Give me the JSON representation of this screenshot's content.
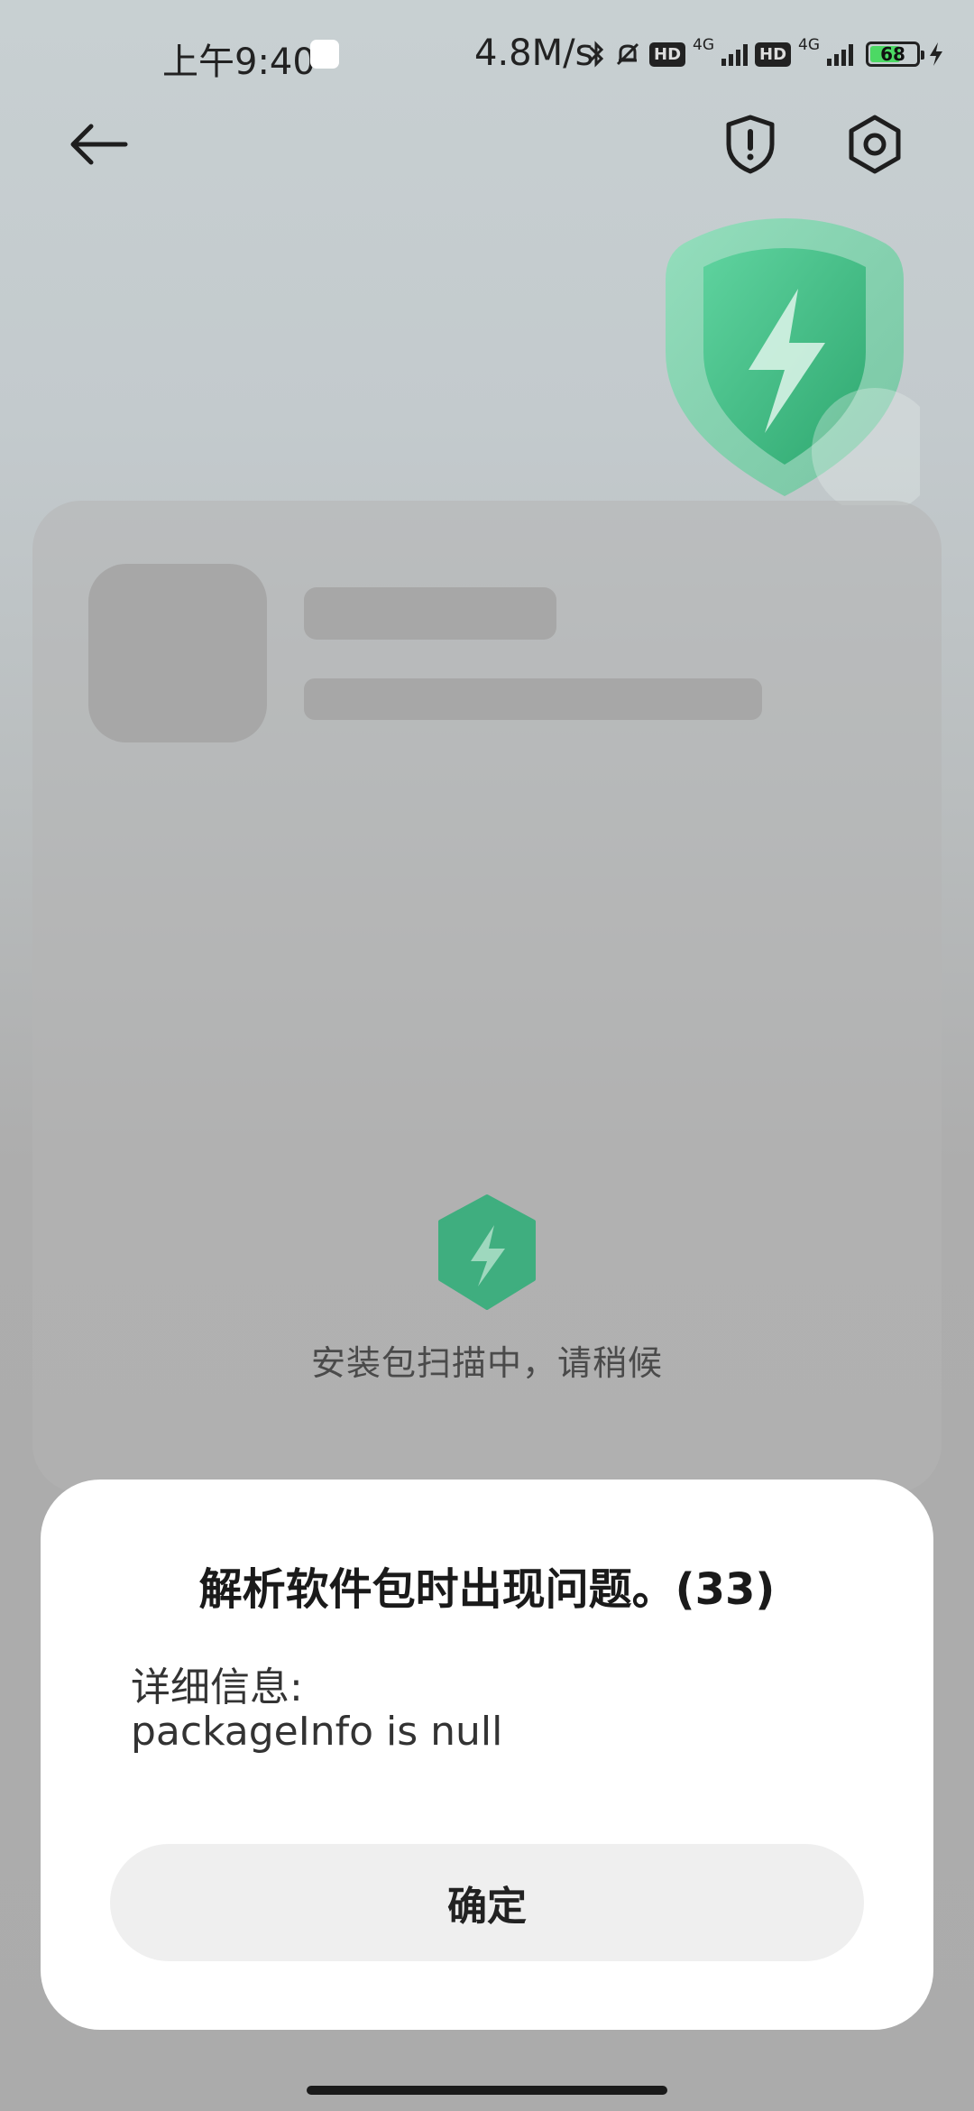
{
  "status_bar": {
    "time": "上午9:40",
    "speed": "4.8M/s",
    "hd_label": "HD",
    "network_label": "4G",
    "battery_level": "68",
    "battery_fraction": 0.68
  },
  "header": {
    "back_icon": "arrow-left-icon",
    "security_icon": "shield-exclamation-icon",
    "settings_icon": "gear-hexagon-icon"
  },
  "scan": {
    "status_text": "安装包扫描中，请稍候",
    "icon": "shield-lightning-icon"
  },
  "dialog": {
    "title": "解析软件包时出现问题。(33)",
    "details_label": "详细信息:",
    "details_text": "packageInfo is null",
    "confirm_label": "确定"
  },
  "colors": {
    "accent_green": "#3fbf85",
    "dialog_bg": "#ffffff",
    "button_bg": "#efefef"
  }
}
